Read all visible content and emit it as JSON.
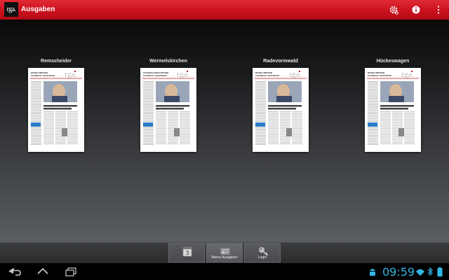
{
  "app": {
    "logo_text": "rga.",
    "title": "Ausgaben",
    "accent_color": "#c8101c"
  },
  "actionbar_icons": [
    "settings-icon",
    "info-icon",
    "overflow-menu-icon"
  ],
  "editions": [
    {
      "name": "Remscheider",
      "masthead": "REMSCHEIDER GENERAL-ANZEIGER",
      "logo": "rga."
    },
    {
      "name": "Wermelskirchen",
      "masthead": "WERMELSKIRCHENER GENERAL-ANZEIGER",
      "logo": "rga."
    },
    {
      "name": "Radevormwald",
      "masthead": "REMSCHEIDER GENERAL-ANZEIGER",
      "logo": "rga."
    },
    {
      "name": "Hückeswagen",
      "masthead": "REMSCHEIDER GENERAL-ANZEIGER",
      "logo": "rga."
    }
  ],
  "tabs": [
    {
      "label": "",
      "icon": "calendar-icon",
      "calendar_day": "3"
    },
    {
      "label": "Meine Ausgaben",
      "icon": "newspaper-icon"
    },
    {
      "label": "Login",
      "icon": "key-icon"
    }
  ],
  "system": {
    "clock": "09:59",
    "nav_icons": [
      "back-icon",
      "home-icon",
      "recent-apps-icon"
    ],
    "status_icons": [
      "android-debug-icon",
      "wifi-icon",
      "bluetooth-icon",
      "battery-icon"
    ],
    "clock_color": "#33b5e5"
  }
}
